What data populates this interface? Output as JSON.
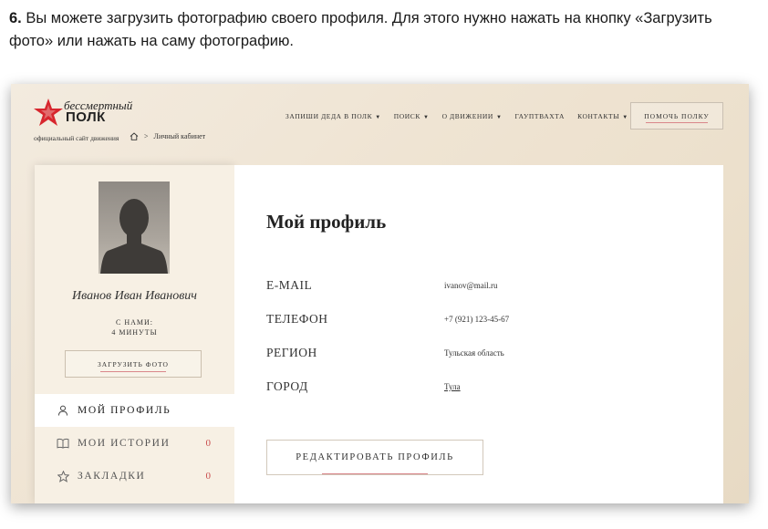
{
  "instruction": {
    "step": "6.",
    "text": " Вы можете загрузить фотографию своего профиля. Для этого нужно нажать на кнопку «Загрузить фото» или нажать на саму фотографию."
  },
  "header": {
    "logo_line1": "бессмертный",
    "logo_line2": "ПОЛК",
    "site_caption": "официальный сайт движения",
    "breadcrumb_current": "Личный кабинет",
    "nav": [
      {
        "label": "ЗАПИШИ ДЕДА В ПОЛК",
        "has_caret": true
      },
      {
        "label": "ПОИСК",
        "has_caret": true
      },
      {
        "label": "О ДВИЖЕНИИ",
        "has_caret": true
      },
      {
        "label": "ГАУПТВАХТА",
        "has_caret": false
      },
      {
        "label": "КОНТАКТЫ",
        "has_caret": true
      }
    ],
    "help_button": "ПОМОЧЬ ПОЛКУ"
  },
  "sidebar": {
    "user_name": "Иванов Иван Иванович",
    "with_us_label": "С НАМИ:",
    "with_us_value": "4 МИНУТЫ",
    "upload_button": "ЗАГРУЗИТЬ ФОТО",
    "menu": [
      {
        "label": "МОЙ ПРОФИЛЬ",
        "icon": "user-icon",
        "count": ""
      },
      {
        "label": "МОИ ИСТОРИИ",
        "icon": "book-icon",
        "count": "0"
      },
      {
        "label": "ЗАКЛАДКИ",
        "icon": "star-icon",
        "count": "0"
      }
    ]
  },
  "main": {
    "title": "Мой профиль",
    "fields": [
      {
        "label": "E-MAIL",
        "value": "ivanov@mail.ru"
      },
      {
        "label": "ТЕЛЕФОН",
        "value": "+7 (921) 123-45-67"
      },
      {
        "label": "РЕГИОН",
        "value": "Тульская область"
      },
      {
        "label": "ГОРОД",
        "value": "Тула"
      }
    ],
    "edit_button": "РЕДАКТИРОВАТЬ ПРОФИЛЬ"
  },
  "colors": {
    "accent": "#d9868a",
    "counter": "#c94c4c",
    "logo_red": "#d7262e",
    "background": "#f1e7d8"
  }
}
